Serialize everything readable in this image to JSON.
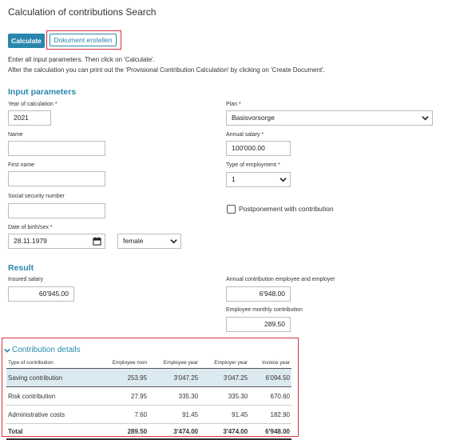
{
  "page": {
    "title": "Calculation of contributions Search"
  },
  "toolbar": {
    "calculate_label": "Calculate",
    "document_label": "Dokument erstellen"
  },
  "intro": {
    "line1": "Enter all input parameters. Then click on 'Calculate'.",
    "line2": "After the calculation you can print out the 'Provisional Contribution Calculation' by clicking on 'Create Document'."
  },
  "input": {
    "heading": "Input parameters",
    "year_label": "Year of calculation *",
    "year_value": "2021",
    "name_label": "Name",
    "name_value": "",
    "firstname_label": "First name",
    "firstname_value": "",
    "ssn_label": "Social security number",
    "ssn_value": "",
    "dob_label": "Date of birth/sex *",
    "dob_value": "28.11.1979",
    "sex_value": "female",
    "plan_label": "Plan *",
    "plan_value": "Basisvorsorge",
    "salary_label": "Annual salary *",
    "salary_value": "100'000.00",
    "employment_label": "Type of employment *",
    "employment_value": "1",
    "postponement_label": "Postponement with contribution",
    "postponement_checked": false
  },
  "result": {
    "heading": "Result",
    "insured_label": "Insured salary",
    "insured_value": "60'945.00",
    "annual_label": "Annual contribution employee and employer",
    "annual_value": "6'948.00",
    "monthly_label": "Employee monthly contribution",
    "monthly_value": "289.50"
  },
  "details": {
    "heading": "Contribution details",
    "columns": [
      "Type of contribution",
      "Employee mon",
      "Employee year",
      "Employer year",
      "Invoice year"
    ],
    "rows": [
      [
        "Saving contribution",
        "253.95",
        "3'047.25",
        "3'047.25",
        "6'094.50"
      ],
      [
        "Risk contribution",
        "27.95",
        "335.30",
        "335.30",
        "670.60"
      ],
      [
        "Administrative costs",
        "7.60",
        "91.45",
        "91.45",
        "182.90"
      ]
    ],
    "total": [
      "Total",
      "289.50",
      "3'474.00",
      "3'474.00",
      "6'948.00"
    ]
  },
  "colors": {
    "accent": "#2a86ad",
    "highlight_border": "#d6323c",
    "row_highlight": "#dbeaf0"
  }
}
